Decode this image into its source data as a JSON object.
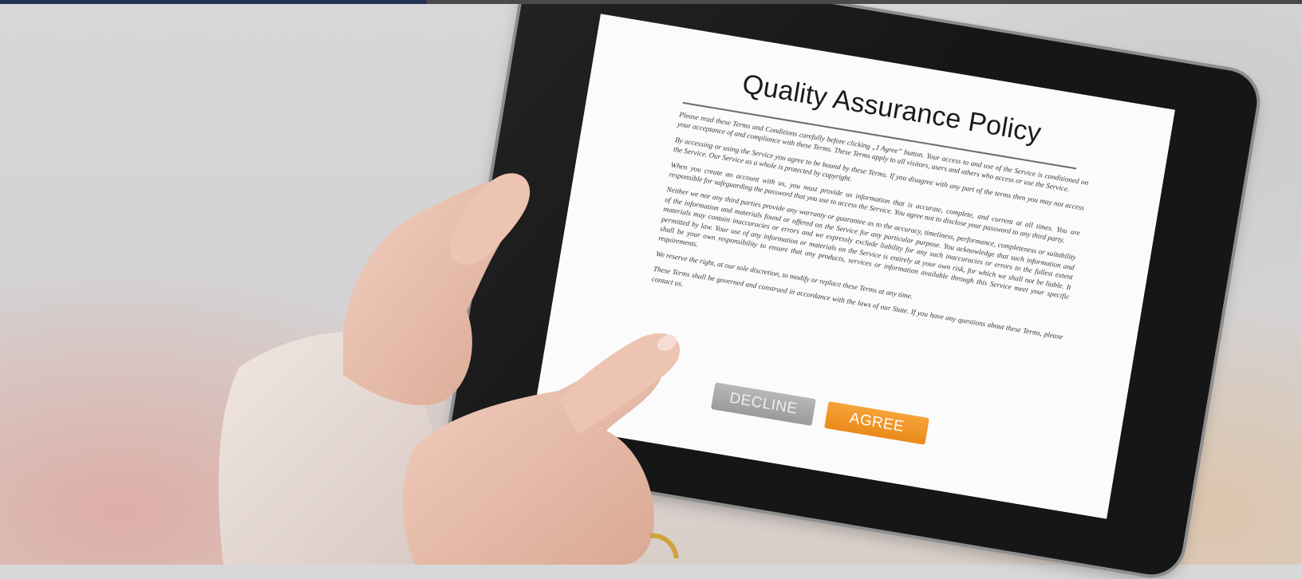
{
  "document": {
    "title": "Quality Assurance Policy",
    "paragraphs": [
      "Please read these Terms and Conditions carefully before clicking „I Agree” button. Your access to and use of the Service is conditioned on your acceptance of and compliance with these Terms. These Terms apply to all visitors, users and others who access or use the Service.",
      "By accessing or using the Service you agree to be bound by these Terms. If you disagree with any part of the terms then you may not access the Service. Our Service as a whole is protected by copyright.",
      "When you create an account with us, you must provide us information that is accurate, complete, and current at all times. You are responsible for safeguarding the password that you use to access the Service. You agree not to disclose your password to any third party.",
      "Neither we nor any third parties provide any warranty or guarantee as to the accuracy, timeliness, performance, completeness or suitability of the information and materials found or offered on the Service for any particular purpose. You acknowledge that such information and materials may contain inaccuracies or errors and we expressly exclude liability for any such inaccuracies or errors to the fullest extent permitted by law. Your use of any information or materials on the Service is entirely at your own risk, for which we shall not be liable. It shall be your own responsibility to ensure that any products, services or information available through this Service meet your specific requirements.",
      "We reserve the right, at our sole discretion, to modify or replace these Terms at any time.",
      "These Terms shall be governed and construed in accordance with the laws of our State. If you have any questions about these Terms, please contact us."
    ],
    "decline_label": "DECLINE",
    "agree_label": "AGREE"
  },
  "colors": {
    "top_bar_left": "#223252",
    "top_bar_right": "#4a4a4a",
    "decline_button": "#a8a8a8",
    "agree_button": "#f0921f",
    "tablet_frame": "#161616",
    "screen": "#fbfbfb"
  }
}
